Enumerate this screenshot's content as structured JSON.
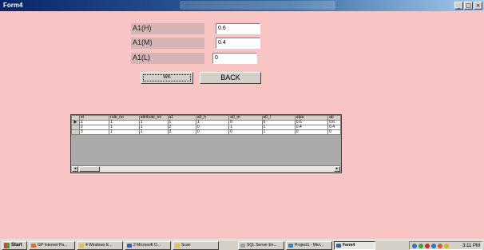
{
  "window": {
    "title": "Form4",
    "controls": [
      "_",
      "□",
      "×"
    ]
  },
  "form": {
    "fields": [
      {
        "label": "A1(H)",
        "value": "0.6"
      },
      {
        "label": "A1(M)",
        "value": "0.4"
      },
      {
        "label": "A1(L)",
        "value": "0"
      }
    ],
    "ok_label": "WK",
    "back_label": "BACK"
  },
  "grid": {
    "columns": [
      "id",
      "rule_no",
      "attribute_no",
      "a1",
      "a0_h",
      "a0_m",
      "a0_l",
      "alpa",
      "ab"
    ],
    "row_marker": "▶",
    "rows": [
      [
        "1",
        "1",
        "1",
        "1",
        "1",
        "0",
        "0",
        "0.6",
        "0.6"
      ],
      [
        "2",
        "1",
        "1",
        "2",
        "0",
        "1",
        "1",
        "0.4",
        "0.4"
      ],
      [
        "3",
        "1",
        "1",
        "3",
        "0",
        "0",
        "1",
        "0",
        "0"
      ]
    ]
  },
  "taskbar": {
    "start_label": "Start",
    "tasks": [
      {
        "label": "GP Internet Pa...",
        "icon_color": "#e07020"
      },
      {
        "label": "4 Windows E...",
        "icon_color": "#e8c040"
      },
      {
        "label": "2 Microsoft O...",
        "icon_color": "#3060c0"
      },
      {
        "label": "Scan",
        "icon_color": "#e8c040"
      },
      {
        "label": "SQL Server En...",
        "icon_color": "#a0a0a0"
      },
      {
        "label": "Project1 - Micr...",
        "icon_color": "#4080c0"
      },
      {
        "label": "Form4",
        "icon_color": "#4060a0",
        "active": true
      }
    ],
    "clock": "3:11 PM"
  }
}
